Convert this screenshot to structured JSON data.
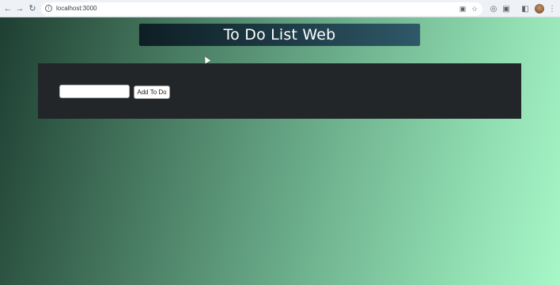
{
  "browser": {
    "url": "localhost:3000",
    "icons": {
      "back": "arrow-left-icon",
      "forward": "arrow-right-icon",
      "reload": "reload-icon",
      "site_info": "info-icon",
      "cast": "cast-icon",
      "bookmark": "star-icon",
      "account_circle": "account-icon",
      "extensions": "puzzle-icon",
      "side_panel": "side-panel-icon",
      "menu": "kebab-menu-icon"
    }
  },
  "page": {
    "title": "To Do List Web",
    "input": {
      "value": "",
      "placeholder": ""
    },
    "add_button_label": "Add To Do"
  },
  "colors": {
    "panel": "#222629",
    "banner_start": "#0e1e24",
    "banner_end": "#2f5868",
    "gradient_start": "#1e3f33",
    "gradient_end": "#a7f7c9"
  }
}
